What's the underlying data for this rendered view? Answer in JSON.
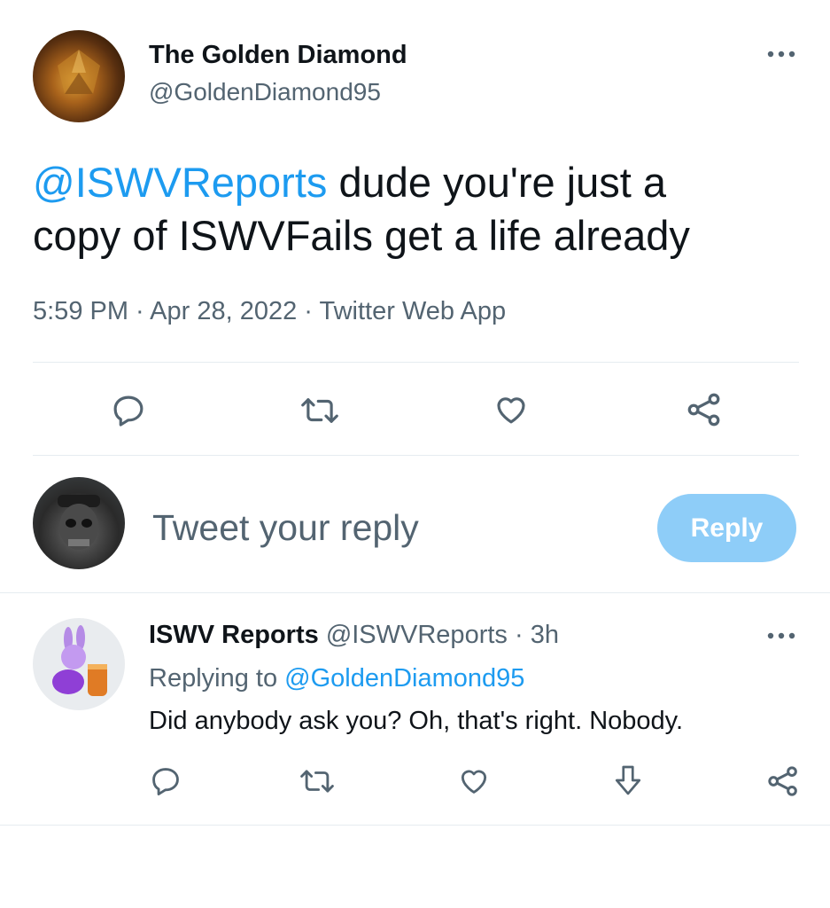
{
  "tweet": {
    "author_name": "The Golden Diamond",
    "author_handle": "@GoldenDiamond95",
    "mention": "@ISWVReports",
    "body_line1": " dude you're just a",
    "body_line2": "copy of ISWVFails get a life already",
    "meta": "5:59 PM · Apr 28, 2022 · Twitter Web App",
    "actions": [
      "reply-icon",
      "retweet-icon",
      "like-icon",
      "share-icon"
    ],
    "more_icon": "more-icon"
  },
  "composer": {
    "placeholder": "Tweet your reply",
    "reply_button": "Reply"
  },
  "reply": {
    "author_name": "ISWV Reports",
    "author_handle": "@ISWVReports",
    "time": " · 3h",
    "replying_prefix": "Replying to ",
    "replying_handle": "@GoldenDiamond95",
    "text": "Did anybody ask you? Oh, that's right. Nobody.",
    "actions": [
      "reply-icon",
      "retweet-icon",
      "like-icon",
      "downvote-icon",
      "share-icon"
    ]
  },
  "colors": {
    "accent": "#1d9bf0",
    "reply_button_disabled": "#8ecdf8",
    "secondary_text": "#536471",
    "divider": "#e6ecf0"
  }
}
